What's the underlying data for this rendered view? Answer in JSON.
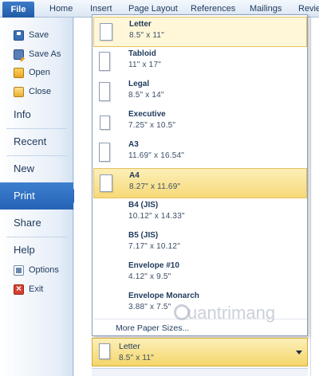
{
  "ribbon": {
    "file_label": "File",
    "tabs": [
      "Home",
      "Insert",
      "Page Layout",
      "References",
      "Mailings",
      "Revie"
    ]
  },
  "backstage": {
    "commands": [
      {
        "label": "Save",
        "icon": "save-icon"
      },
      {
        "label": "Save As",
        "icon": "save-as-icon"
      },
      {
        "label": "Open",
        "icon": "open-folder-icon"
      },
      {
        "label": "Close",
        "icon": "close-folder-icon"
      }
    ],
    "sections": [
      "Info",
      "Recent",
      "New",
      "Print",
      "Share",
      "Help"
    ],
    "selected_section": "Print",
    "footer": [
      {
        "label": "Options",
        "icon": "options-icon"
      },
      {
        "label": "Exit",
        "icon": "exit-icon"
      }
    ]
  },
  "paper_sizes": [
    {
      "name": "Letter",
      "size": "8.5\" x 11\""
    },
    {
      "name": "Tabloid",
      "size": "11\" x 17\""
    },
    {
      "name": "Legal",
      "size": "8.5\" x 14\""
    },
    {
      "name": "Executive",
      "size": "7.25\" x 10.5\""
    },
    {
      "name": "A3",
      "size": "11.69\" x 16.54\""
    },
    {
      "name": "A4",
      "size": "8.27\" x 11.69\""
    },
    {
      "name": "B4 (JIS)",
      "size": "10.12\" x 14.33\""
    },
    {
      "name": "B5 (JIS)",
      "size": "7.17\" x 10.12\""
    },
    {
      "name": "Envelope #10",
      "size": "4.12\" x 9.5\""
    },
    {
      "name": "Envelope Monarch",
      "size": "3.88\" x 7.5\""
    }
  ],
  "highlighted_paper": "A4",
  "more_sizes_label": "More Paper Sizes...",
  "current_paper": {
    "name": "Letter",
    "size": "8.5\" x 11\""
  },
  "watermark_text": "uantrimang"
}
